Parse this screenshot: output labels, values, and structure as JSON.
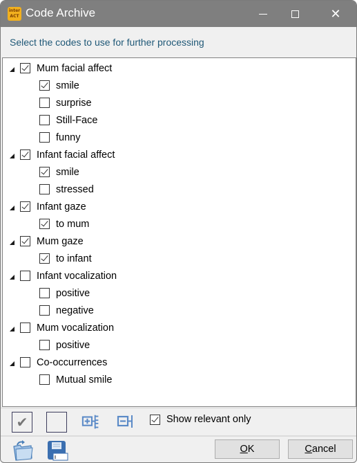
{
  "window": {
    "title": "Code Archive",
    "app_icon": "interact-app-icon",
    "controls": {
      "minimize": "minimize-icon",
      "maximize": "maximize-icon",
      "close": "close-icon"
    }
  },
  "instruction": "Select the codes to use for further processing",
  "tree": [
    {
      "label": "Mum facial affect",
      "checked": true,
      "children": [
        {
          "label": "smile",
          "checked": true
        },
        {
          "label": "surprise",
          "checked": false
        },
        {
          "label": "Still-Face",
          "checked": false
        },
        {
          "label": "funny",
          "checked": false
        }
      ]
    },
    {
      "label": "Infant facial affect",
      "checked": true,
      "children": [
        {
          "label": "smile",
          "checked": true
        },
        {
          "label": "stressed",
          "checked": false
        }
      ]
    },
    {
      "label": "Infant gaze",
      "checked": true,
      "children": [
        {
          "label": "to mum",
          "checked": true
        }
      ]
    },
    {
      "label": "Mum gaze",
      "checked": true,
      "children": [
        {
          "label": "to infant",
          "checked": true
        }
      ]
    },
    {
      "label": "Infant vocalization",
      "checked": false,
      "children": [
        {
          "label": "positive",
          "checked": false
        },
        {
          "label": "negative",
          "checked": false
        }
      ]
    },
    {
      "label": "Mum vocalization",
      "checked": false,
      "children": [
        {
          "label": "positive",
          "checked": false
        }
      ]
    },
    {
      "label": "Co-occurrences",
      "checked": false,
      "children": [
        {
          "label": "Mutual smile",
          "checked": false
        }
      ]
    }
  ],
  "toolbar": {
    "check_all": "check-all-icon",
    "uncheck_all": "uncheck-all-icon",
    "expand_all": "expand-all-icon",
    "collapse_all": "collapse-all-icon",
    "show_relevant_label": "Show relevant only",
    "show_relevant_checked": true
  },
  "footer": {
    "open_icon": "open-folder-icon",
    "save_icon": "save-icon",
    "ok_mnemonic": "O",
    "ok_rest": "K",
    "cancel_mnemonic": "C",
    "cancel_rest": "ancel"
  }
}
